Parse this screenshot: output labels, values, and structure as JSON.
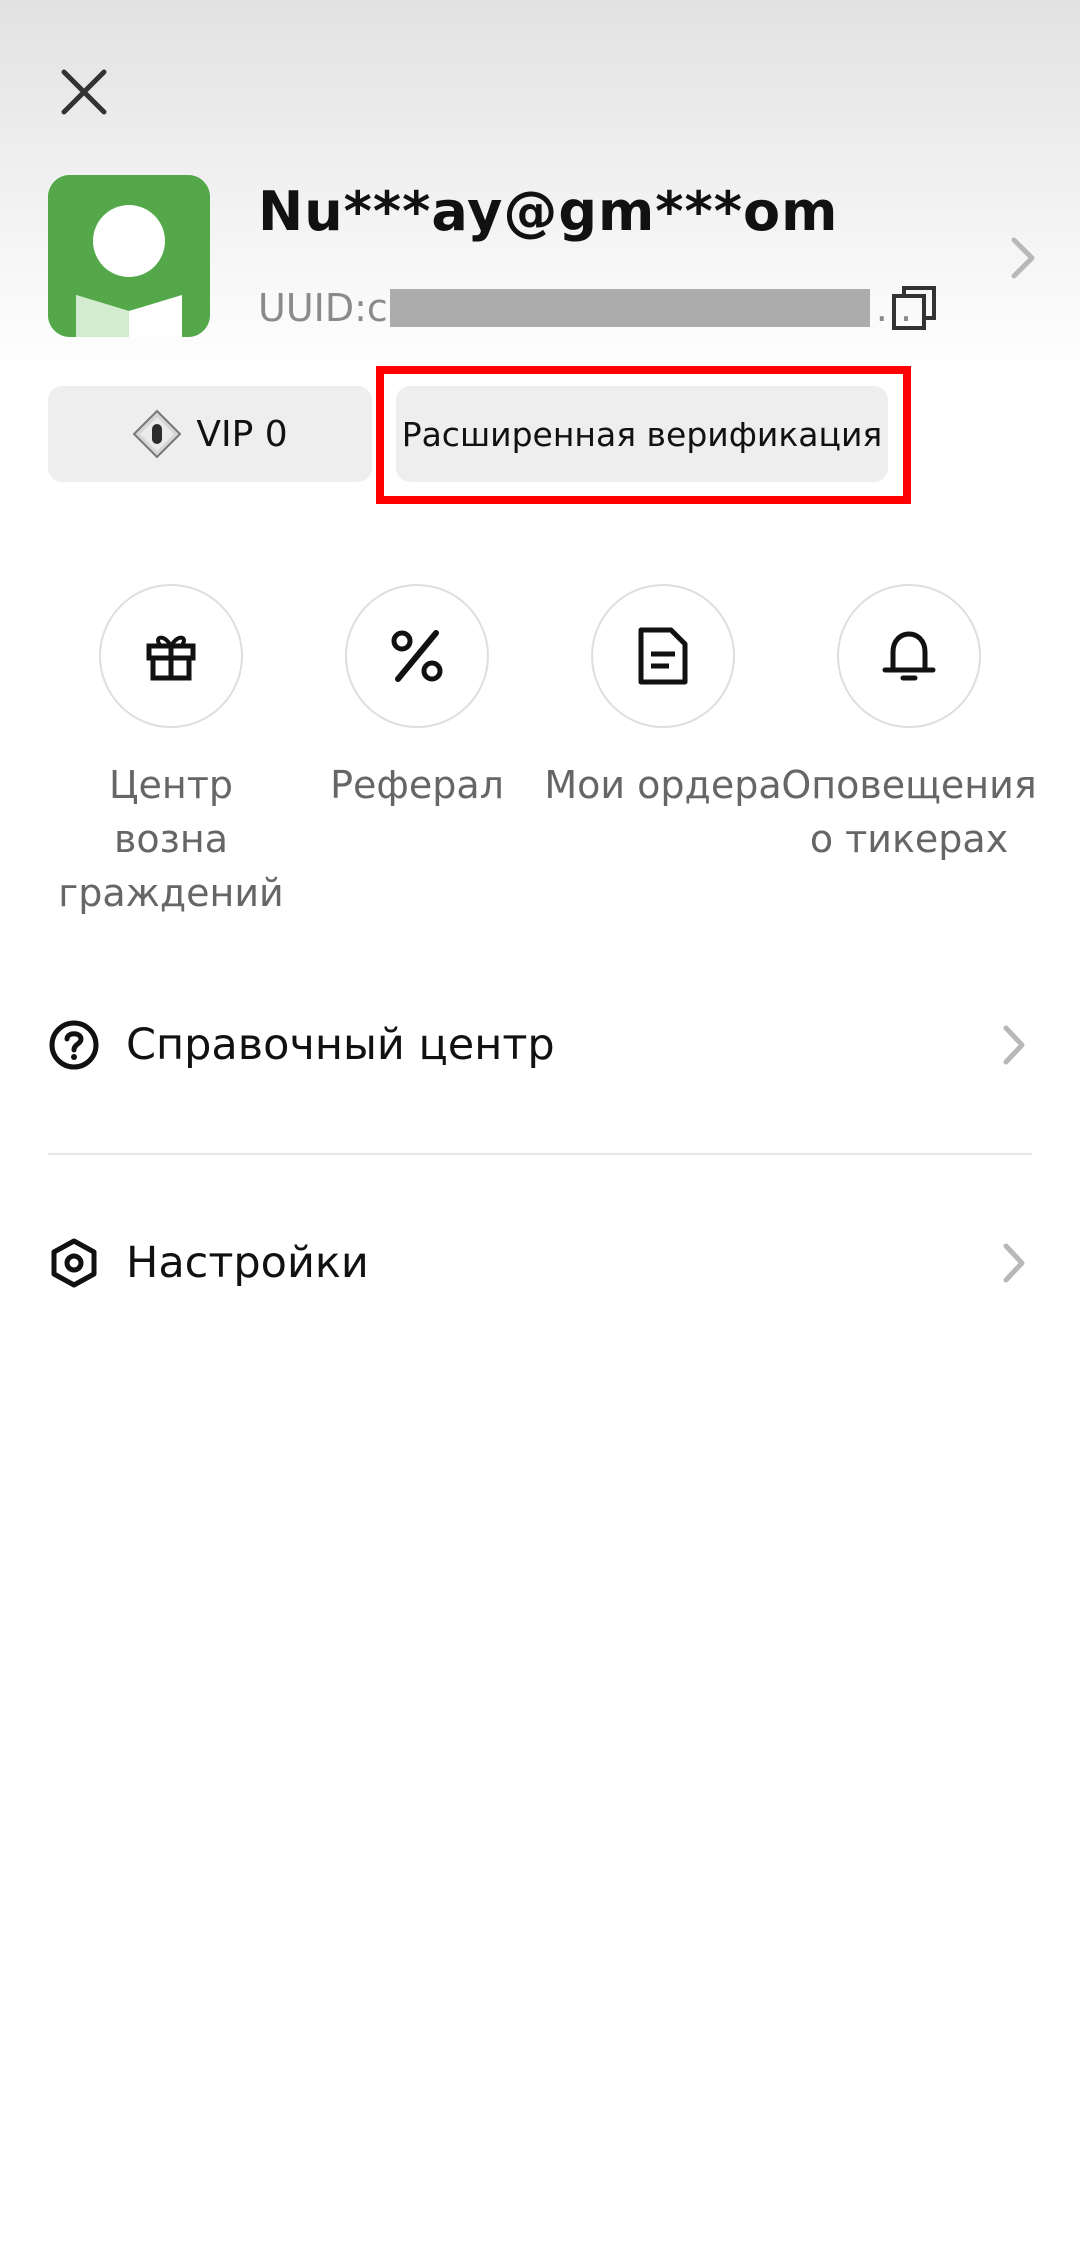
{
  "header": {
    "email": "Nu***ay@gm***om",
    "uid_prefix": "UUID:c",
    "uid_ellipsis": "..."
  },
  "badges": {
    "vip_label": "VIP 0",
    "verification_label": "Расширенная верификация"
  },
  "quick_actions": [
    {
      "label": "Центр возна\nграждений",
      "icon": "gift-icon"
    },
    {
      "label": "Реферал",
      "icon": "percent-icon"
    },
    {
      "label": "Мои ордера",
      "icon": "document-icon"
    },
    {
      "label": "Оповещения\nо тикерах",
      "icon": "bell-icon"
    }
  ],
  "menu": {
    "help_center": "Справочный центр",
    "settings": "Настройки"
  },
  "colors": {
    "avatar_bg": "#54a84a",
    "highlight_frame": "#ff0000"
  }
}
